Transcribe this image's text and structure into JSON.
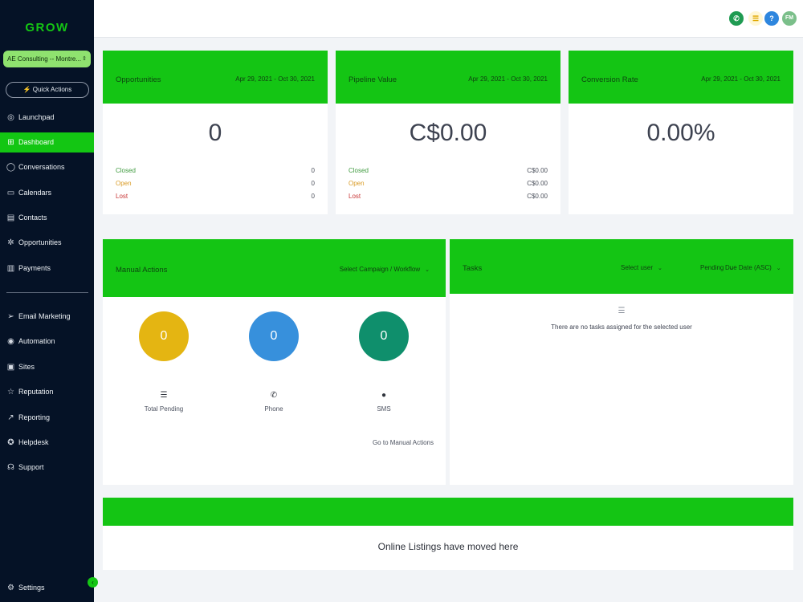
{
  "sidebar": {
    "logo": "GROW",
    "account": "AE Consulting -- Montre...",
    "quick_actions": "Quick Actions",
    "items": [
      {
        "label": "Launchpad",
        "icon": "rocket-icon"
      },
      {
        "label": "Dashboard",
        "icon": "grid-icon"
      },
      {
        "label": "Conversations",
        "icon": "chat-icon"
      },
      {
        "label": "Calendars",
        "icon": "calendar-icon"
      },
      {
        "label": "Contacts",
        "icon": "contacts-icon"
      },
      {
        "label": "Opportunities",
        "icon": "opportunities-icon"
      },
      {
        "label": "Payments",
        "icon": "payments-icon"
      }
    ],
    "items2": [
      {
        "label": "Email Marketing",
        "icon": "send-icon"
      },
      {
        "label": "Automation",
        "icon": "automation-icon"
      },
      {
        "label": "Sites",
        "icon": "sites-icon"
      },
      {
        "label": "Reputation",
        "icon": "star-icon"
      },
      {
        "label": "Reporting",
        "icon": "trend-icon"
      },
      {
        "label": "Helpdesk",
        "icon": "helpdesk-icon"
      },
      {
        "label": "Support",
        "icon": "headset-icon"
      }
    ],
    "settings": "Settings",
    "active_color": "#13c613",
    "bg_color": "#051226"
  },
  "topbar": {
    "avatar_initials": "FM",
    "help_label": "?"
  },
  "opportunities": {
    "title": "Opportunities",
    "date_range": "Apr 29, 2021 - Oct 30, 2021",
    "value": "0",
    "rows": [
      {
        "label": "Closed",
        "value": "0"
      },
      {
        "label": "Open",
        "value": "0"
      },
      {
        "label": "Lost",
        "value": "0"
      }
    ]
  },
  "pipeline": {
    "title": "Pipeline Value",
    "date_range": "Apr 29, 2021 - Oct 30, 2021",
    "value": "C$0.00",
    "rows": [
      {
        "label": "Closed",
        "value": "C$0.00"
      },
      {
        "label": "Open",
        "value": "C$0.00"
      },
      {
        "label": "Lost",
        "value": "C$0.00"
      }
    ]
  },
  "conversion": {
    "title": "Conversion Rate",
    "date_range": "Apr 29, 2021 - Oct 30, 2021",
    "value": "0.00%"
  },
  "manual_actions": {
    "title": "Manual Actions",
    "campaign_select": "Select Campaign / Workflow",
    "stats": [
      {
        "label": "Total Pending",
        "value": "0",
        "color": "#e4b512",
        "icon": "list-icon"
      },
      {
        "label": "Phone",
        "value": "0",
        "color": "#3790dc",
        "icon": "phone-icon"
      },
      {
        "label": "SMS",
        "value": "0",
        "color": "#0f8f6c",
        "icon": "sms-icon"
      }
    ],
    "link": "Go to Manual Actions"
  },
  "tasks": {
    "title": "Tasks",
    "user_select": "Select user",
    "status_select": "Pending",
    "sort_select": "Due Date (ASC)",
    "empty_text": "There are no tasks assigned for the selected user"
  },
  "listings": {
    "message": "Online Listings have moved here"
  },
  "colors": {
    "header_green": "#14c514",
    "phone_icon": "#1f9b52",
    "notif_icon": "#f5c542",
    "help_icon": "#2e86de",
    "avatar": "#7bbf8a"
  }
}
